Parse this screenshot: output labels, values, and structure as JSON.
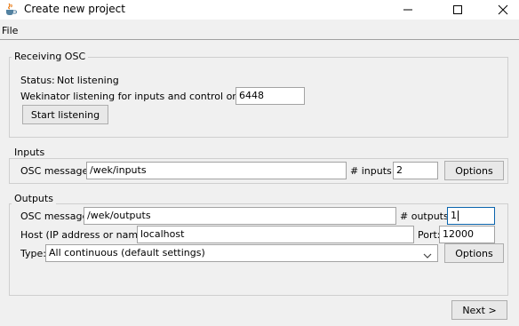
{
  "window": {
    "title": "Create new project",
    "icon": "java-coffee-icon"
  },
  "menu": {
    "file": "File"
  },
  "receiving_osc": {
    "title": "Receiving OSC",
    "status_label": "Status:",
    "status_value": "Not listening",
    "port_label": "Wekinator listening for inputs and control on port:",
    "port_value": "6448",
    "start_button": "Start listening"
  },
  "inputs": {
    "title": "Inputs",
    "osc_label": "OSC message:",
    "osc_value": "/wek/inputs",
    "count_label": "# inputs:",
    "count_value": "2",
    "options_button": "Options"
  },
  "outputs": {
    "title": "Outputs",
    "osc_label": "OSC message:",
    "osc_value": "/wek/outputs",
    "count_label": "# outputs:",
    "count_value": "1",
    "host_label": "Host (IP address or name):",
    "host_value": "localhost",
    "port_label": "Port:",
    "port_value": "12000",
    "type_label": "Type:",
    "type_value": "All continuous (default settings)",
    "options_button": "Options"
  },
  "footer": {
    "next_button": "Next >"
  }
}
